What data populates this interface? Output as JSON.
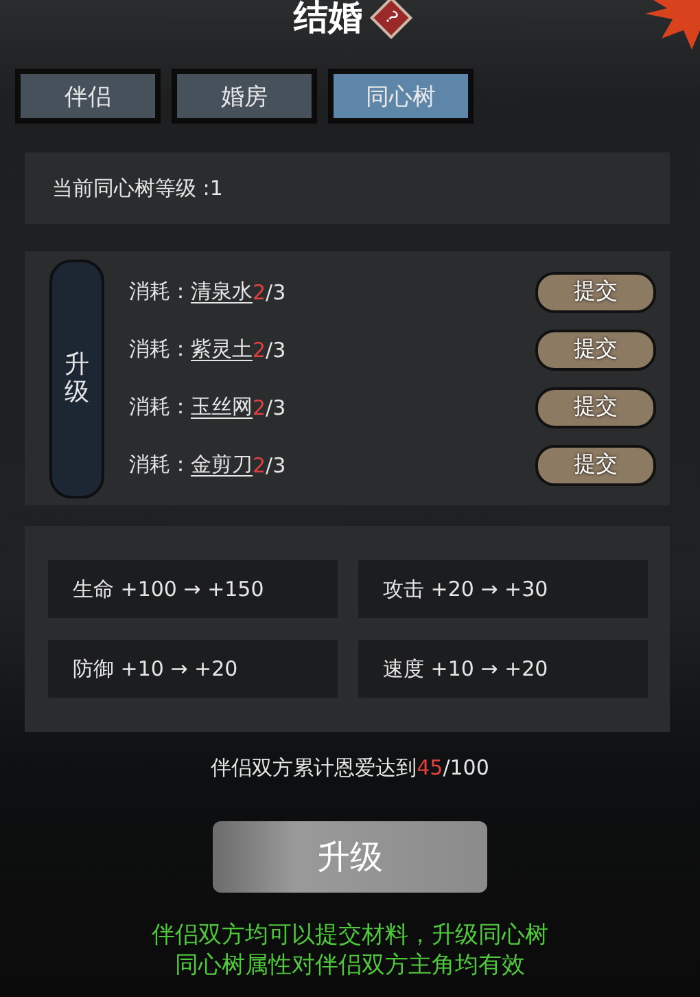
{
  "window": {
    "title": "结婚",
    "help": "?"
  },
  "tabs": [
    {
      "label": "伴侣",
      "selected": false
    },
    {
      "label": "婚房",
      "selected": false
    },
    {
      "label": "同心树",
      "selected": true
    }
  ],
  "level_text": "当前同心树等级 :1",
  "upgrade_side": "升级",
  "materials": [
    {
      "label": "消耗：",
      "name": "清泉水",
      "have": "2",
      "need": "/3",
      "button": "提交"
    },
    {
      "label": "消耗：",
      "name": "紫灵土",
      "have": "2",
      "need": "/3",
      "button": "提交"
    },
    {
      "label": "消耗：",
      "name": "玉丝网",
      "have": "2",
      "need": "/3",
      "button": "提交"
    },
    {
      "label": "消耗：",
      "name": "金剪刀",
      "have": "2",
      "need": "/3",
      "button": "提交"
    }
  ],
  "stats": [
    "生命 +100 → +150",
    "攻击 +20 → +30",
    "防御 +10 → +20",
    "速度 +10 → +20"
  ],
  "progress": {
    "prefix": "伴侣双方累计恩爱达到",
    "current": "45",
    "total": "/100"
  },
  "upgrade_button": "升级",
  "notes": [
    "伴侣双方均可以提交材料，升级同心树",
    "同心树属性对伴侣双方主角均有效"
  ]
}
